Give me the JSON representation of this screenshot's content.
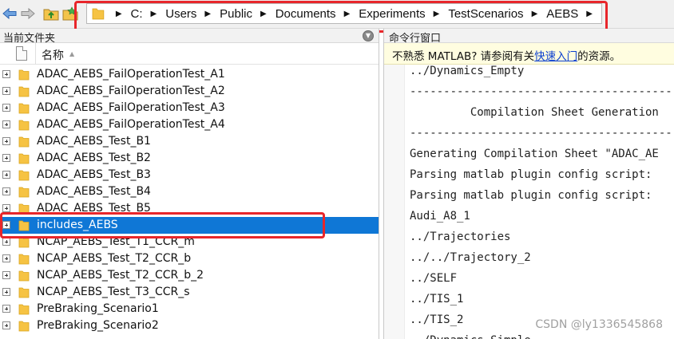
{
  "address_bar": {
    "segments": [
      "C:",
      "Users",
      "Public",
      "Documents",
      "Experiments",
      "TestScenarios",
      "AEBS"
    ]
  },
  "current_folder": {
    "title": "当前文件夹",
    "column_name": "名称",
    "items": [
      {
        "name": "ADAC_AEBS_FailOperationTest_A1",
        "selected": false
      },
      {
        "name": "ADAC_AEBS_FailOperationTest_A2",
        "selected": false
      },
      {
        "name": "ADAC_AEBS_FailOperationTest_A3",
        "selected": false
      },
      {
        "name": "ADAC_AEBS_FailOperationTest_A4",
        "selected": false
      },
      {
        "name": "ADAC_AEBS_Test_B1",
        "selected": false
      },
      {
        "name": "ADAC_AEBS_Test_B2",
        "selected": false
      },
      {
        "name": "ADAC_AEBS_Test_B3",
        "selected": false
      },
      {
        "name": "ADAC_AEBS_Test_B4",
        "selected": false
      },
      {
        "name": "ADAC_AEBS_Test_B5",
        "selected": false
      },
      {
        "name": "includes_AEBS",
        "selected": true
      },
      {
        "name": "NCAP_AEBS_Test_T1_CCR_m",
        "selected": false
      },
      {
        "name": "NCAP_AEBS_Test_T2_CCR_b",
        "selected": false
      },
      {
        "name": "NCAP_AEBS_Test_T2_CCR_b_2",
        "selected": false
      },
      {
        "name": "NCAP_AEBS_Test_T3_CCR_s",
        "selected": false
      },
      {
        "name": "PreBraking_Scenario1",
        "selected": false
      },
      {
        "name": "PreBraking_Scenario2",
        "selected": false
      }
    ]
  },
  "command_window": {
    "title": "命令行窗口",
    "info": {
      "prefix": "不熟悉 MATLAB? 请参阅有关",
      "link": "快速入门",
      "suffix": "的资源。"
    },
    "lines": [
      "../Dynamics_Empty",
      "----------------------------------------------",
      "         Compilation Sheet Generation",
      "----------------------------------------------",
      "Generating Compilation Sheet \"ADAC_AE",
      "Parsing matlab plugin config script:",
      "Parsing matlab plugin config script:",
      "Audi_A8_1",
      "../Trajectories",
      "../../Trajectory_2",
      "../SELF",
      "../TIS_1",
      "../TIS_2",
      "../Dynamics_Simple"
    ]
  },
  "watermark": "CSDN @ly1336545868",
  "colors": {
    "selection": "#0f77d6",
    "highlight_box": "#e8262b",
    "folder": "#f6c343",
    "info_bar": "#fffde0",
    "link": "#0b3fcf"
  },
  "icons": [
    "back-arrow-icon",
    "forward-arrow-icon",
    "up-folder-icon",
    "browse-folder-icon",
    "folder-icon",
    "pane-menu-icon",
    "sort-ascending-icon",
    "expand-plus-icon"
  ]
}
